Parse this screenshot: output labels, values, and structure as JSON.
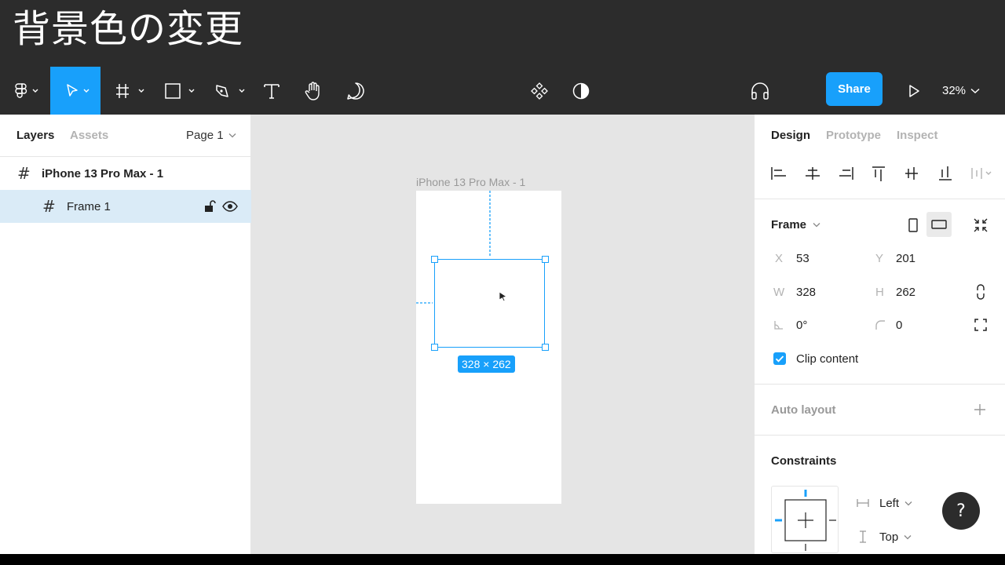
{
  "title": "背景色の変更",
  "toolbar": {
    "share_label": "Share",
    "zoom_label": "32%",
    "tools": [
      "figma-menu-icon",
      "move-tool-icon",
      "frame-tool-icon",
      "rectangle-tool-icon",
      "pen-tool-icon",
      "text-tool-icon",
      "hand-tool-icon",
      "comment-tool-icon"
    ]
  },
  "left_panel": {
    "tab_layers": "Layers",
    "tab_assets": "Assets",
    "page_label": "Page 1",
    "layers": [
      {
        "name": "iPhone 13 Pro Max - 1",
        "selected": false
      },
      {
        "name": "Frame 1",
        "selected": true
      }
    ]
  },
  "canvas": {
    "frame_label": "iPhone 13 Pro Max - 1",
    "size_badge": "328 × 262"
  },
  "right_panel": {
    "tab_design": "Design",
    "tab_prototype": "Prototype",
    "tab_inspect": "Inspect",
    "frame_dropdown": "Frame",
    "x_label": "X",
    "x_value": "53",
    "y_label": "Y",
    "y_value": "201",
    "w_label": "W",
    "w_value": "328",
    "h_label": "H",
    "h_value": "262",
    "rotation_value": "0°",
    "radius_value": "0",
    "clip_content_label": "Clip content",
    "clip_content_checked": true,
    "auto_layout_title": "Auto layout",
    "constraints_title": "Constraints",
    "constraint_h": "Left",
    "constraint_v": "Top"
  },
  "help_label": "?",
  "colors": {
    "accent": "#18a0fb",
    "toolbar_bg": "#2c2c2c",
    "canvas_bg": "#e5e5e5",
    "selection_bg": "#daebf7"
  }
}
